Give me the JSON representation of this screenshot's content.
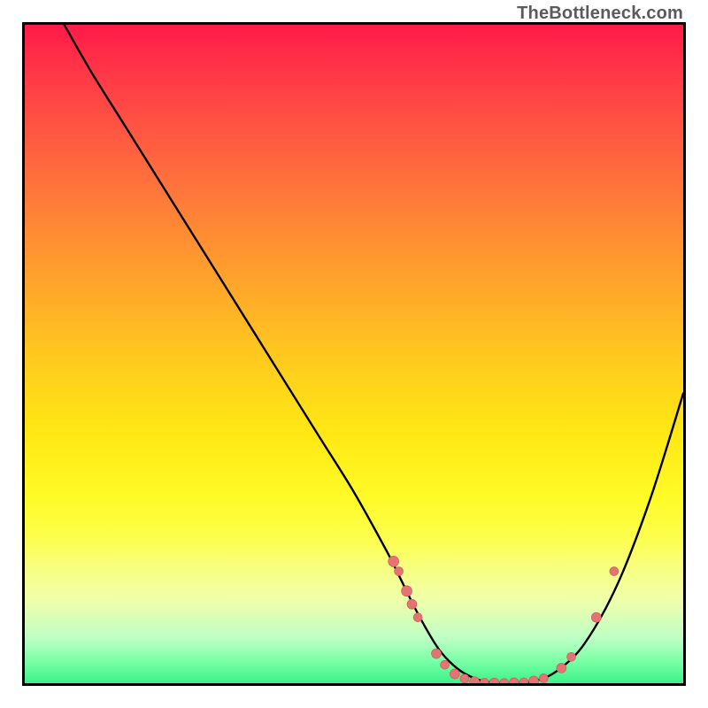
{
  "watermark": "TheBottleneck.com",
  "colors": {
    "curve": "#000000",
    "dot_fill": "#e57373",
    "dot_stroke": "#c85a5a",
    "border": "#000000"
  },
  "chart_data": {
    "type": "line",
    "title": "",
    "xlabel": "",
    "ylabel": "",
    "xlim": [
      0,
      100
    ],
    "ylim": [
      0,
      100
    ],
    "grid": false,
    "note": "Axes are unlabeled; values are read in percentage of the plot area (0 = left/bottom, 100 = right/top).",
    "series": [
      {
        "name": "bottleneck-curve",
        "x": [
          6,
          10,
          15,
          20,
          25,
          30,
          35,
          40,
          45,
          50,
          55,
          57,
          60,
          63,
          66,
          69,
          72,
          75,
          78,
          81,
          85,
          90,
          95,
          100
        ],
        "y": [
          100,
          93,
          85,
          77,
          69,
          61,
          53,
          45,
          37,
          29,
          20,
          16,
          10,
          5,
          2,
          0.5,
          0,
          0,
          0.5,
          2,
          6,
          15,
          28,
          44
        ]
      }
    ],
    "markers": [
      {
        "x": 56.0,
        "y": 18.5,
        "r": 6
      },
      {
        "x": 56.8,
        "y": 17.0,
        "r": 5
      },
      {
        "x": 58.0,
        "y": 14.0,
        "r": 6
      },
      {
        "x": 58.8,
        "y": 12.0,
        "r": 5.5
      },
      {
        "x": 59.7,
        "y": 10.0,
        "r": 5
      },
      {
        "x": 62.5,
        "y": 4.5,
        "r": 5.5
      },
      {
        "x": 63.8,
        "y": 2.8,
        "r": 5
      },
      {
        "x": 65.3,
        "y": 1.4,
        "r": 5.5
      },
      {
        "x": 66.8,
        "y": 0.7,
        "r": 5
      },
      {
        "x": 68.3,
        "y": 0.25,
        "r": 5.5
      },
      {
        "x": 69.8,
        "y": 0.1,
        "r": 5
      },
      {
        "x": 71.3,
        "y": 0.05,
        "r": 5.5
      },
      {
        "x": 72.8,
        "y": 0.05,
        "r": 5
      },
      {
        "x": 74.3,
        "y": 0.07,
        "r": 5.5
      },
      {
        "x": 75.8,
        "y": 0.15,
        "r": 5
      },
      {
        "x": 77.3,
        "y": 0.35,
        "r": 5.5
      },
      {
        "x": 78.8,
        "y": 0.75,
        "r": 5
      },
      {
        "x": 81.5,
        "y": 2.3,
        "r": 5.5
      },
      {
        "x": 83.0,
        "y": 4.0,
        "r": 5
      },
      {
        "x": 86.8,
        "y": 10.0,
        "r": 5.5
      },
      {
        "x": 89.5,
        "y": 17.0,
        "r": 5
      }
    ]
  }
}
